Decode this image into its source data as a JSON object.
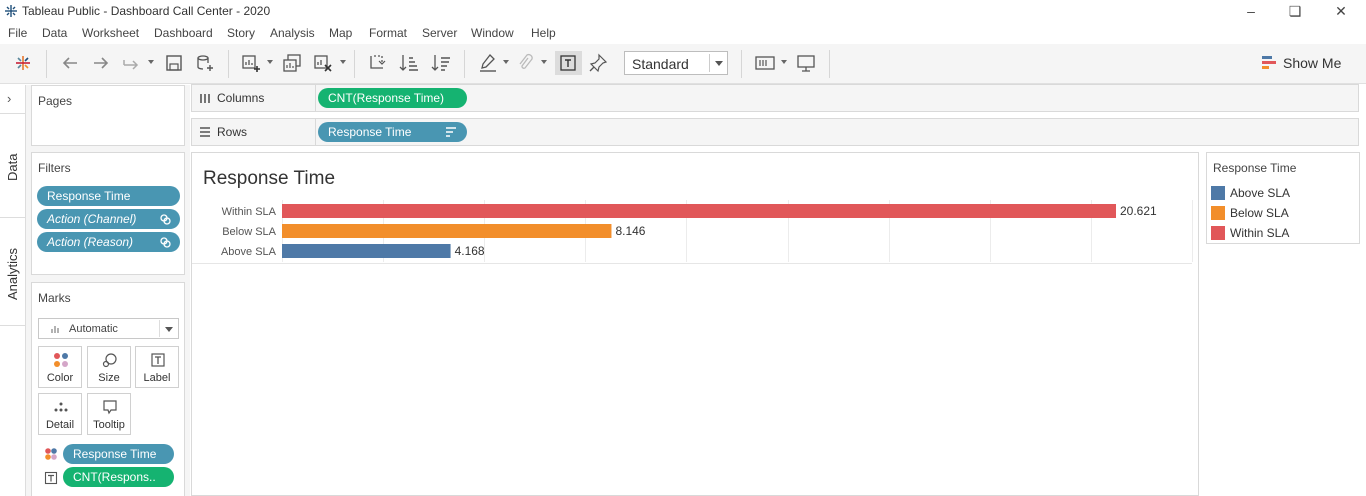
{
  "window": {
    "title": "Tableau Public - Dashboard Call Center - 2020"
  },
  "menu": [
    "File",
    "Data",
    "Worksheet",
    "Dashboard",
    "Story",
    "Analysis",
    "Map",
    "Format",
    "Server",
    "Window",
    "Help"
  ],
  "toolbar": {
    "fit_value": "Standard",
    "show_me_label": "Show Me"
  },
  "side_tabs": {
    "data": "Data",
    "analytics": "Analytics"
  },
  "pages_panel": {
    "title": "Pages"
  },
  "filters_panel": {
    "title": "Filters",
    "items": [
      "Response Time",
      "Action (Channel)",
      "Action (Reason)"
    ]
  },
  "marks_panel": {
    "title": "Marks",
    "mark_type": "Automatic",
    "buttons": [
      "Color",
      "Size",
      "Label",
      "Detail",
      "Tooltip"
    ],
    "fields": [
      "Response Time",
      "CNT(Respons.."
    ]
  },
  "shelves": {
    "columns_label": "Columns",
    "columns_pill": "CNT(Response Time)",
    "rows_label": "Rows",
    "rows_pill": "Response Time"
  },
  "sheet": {
    "title": "Response Time"
  },
  "legend": {
    "title": "Response Time",
    "items": [
      {
        "label": "Above SLA",
        "color": "#4e79a7"
      },
      {
        "label": "Below SLA",
        "color": "#f28e2b"
      },
      {
        "label": "Within SLA",
        "color": "#e15759"
      }
    ]
  },
  "chart_data": {
    "type": "bar",
    "orientation": "horizontal",
    "categories": [
      "Within SLA",
      "Below SLA",
      "Above SLA"
    ],
    "values": [
      20621,
      8146,
      4168
    ],
    "value_labels": [
      "20.621",
      "8.146",
      "4.168"
    ],
    "colors": [
      "#e15759",
      "#f28e2b",
      "#4e79a7"
    ],
    "xlim": [
      0,
      22500
    ],
    "grid": true,
    "title": "Response Time"
  }
}
